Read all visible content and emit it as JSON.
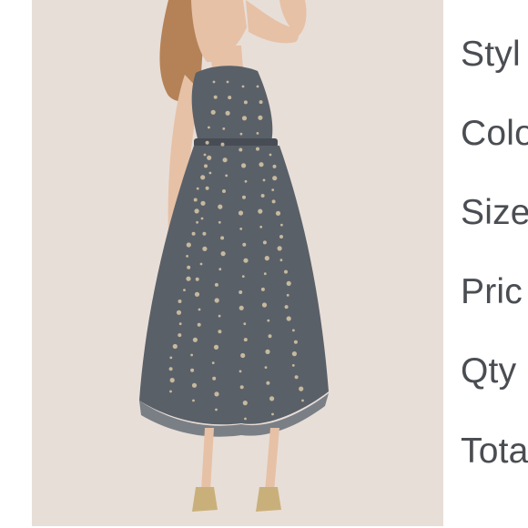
{
  "product_image": {
    "alt": "Embroidered grey midi dress",
    "colors": {
      "background": "#e8ded8",
      "dress": "#5a6068",
      "dress_shadow": "#484d55",
      "embroidery": "#d9c9a8",
      "skin": "#e6c1a6",
      "hair": "#b58257",
      "shoes": "#c9b07a"
    }
  },
  "details": {
    "labels": [
      "Styl",
      "Colo",
      "Size",
      "Pric",
      "Qty",
      "Tota"
    ]
  }
}
